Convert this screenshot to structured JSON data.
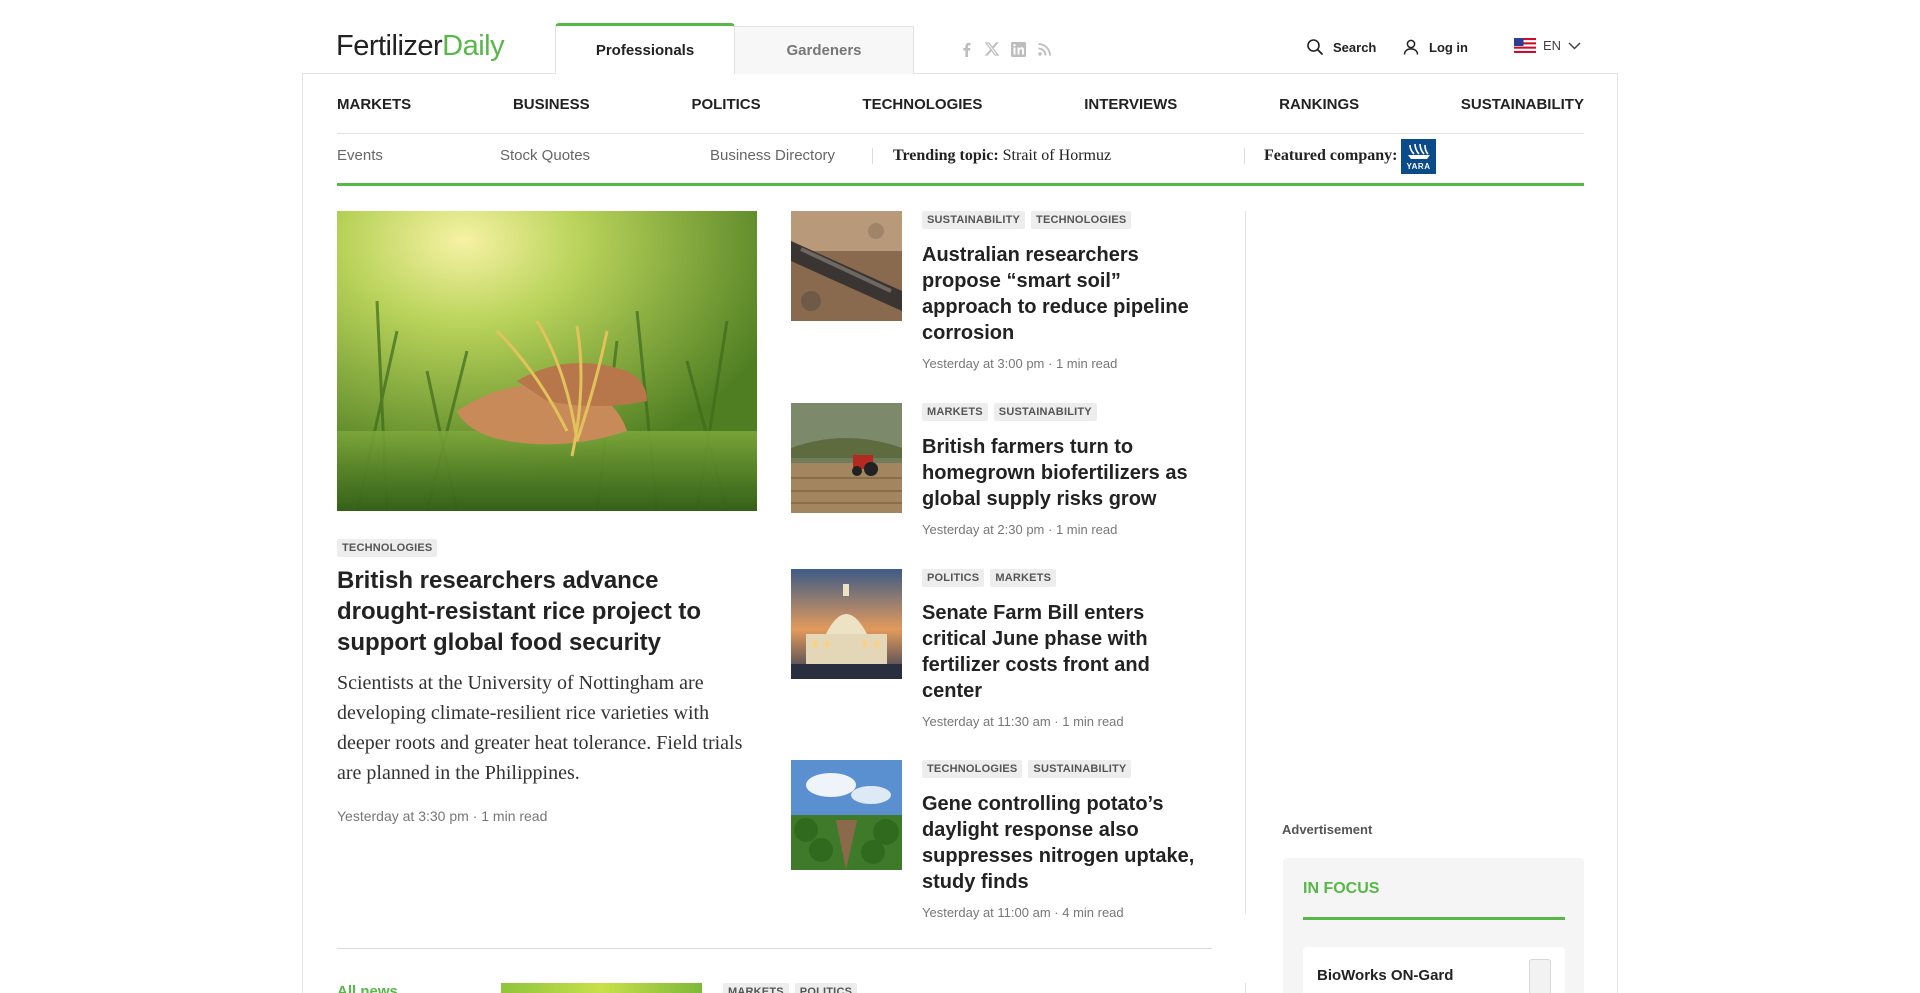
{
  "header": {
    "logo_part1": "Fertilizer",
    "logo_part2": "Daily",
    "audience_tabs": [
      {
        "label": "Professionals",
        "active": true
      },
      {
        "label": "Gardeners",
        "active": false
      }
    ],
    "social_icons": [
      "facebook-icon",
      "x-icon",
      "linkedin-icon",
      "rss-icon"
    ],
    "search_label": "Search",
    "login_label": "Log in",
    "language": "EN"
  },
  "main_nav": [
    "MARKETS",
    "BUSINESS",
    "POLITICS",
    "TECHNOLOGIES",
    "INTERVIEWS",
    "RANKINGS",
    "SUSTAINABILITY"
  ],
  "sub_nav": {
    "items": [
      "Events",
      "Stock Quotes",
      "Business Directory"
    ],
    "trending_label": "Trending topic:",
    "trending_value": "Strait of Hormuz",
    "featured_label": "Featured company:",
    "featured_logo_text": "YARA"
  },
  "featured_article": {
    "tags": [
      "TECHNOLOGIES"
    ],
    "title": "British researchers advance drought-resistant rice project to support global food security",
    "description": "Scientists at the University of Nottingham are developing climate-resilient rice varieties with deeper roots and greater heat tolerance. Field trials are planned in the Philippines.",
    "time": "Yesterday at 3:30 pm",
    "read": "· 1 min read"
  },
  "side_articles": [
    {
      "tags": [
        "SUSTAINABILITY",
        "TECHNOLOGIES"
      ],
      "title": "Australian researchers propose “smart soil” approach to reduce pipeline corrosion",
      "time": "Yesterday at 3:00 pm",
      "read": "· 1 min read"
    },
    {
      "tags": [
        "MARKETS",
        "SUSTAINABILITY"
      ],
      "title": "British farmers turn to homegrown biofertilizers as global supply risks grow",
      "time": "Yesterday at 2:30 pm",
      "read": "· 1 min read"
    },
    {
      "tags": [
        "POLITICS",
        "MARKETS"
      ],
      "title": "Senate Farm Bill enters critical June phase with fertilizer costs front and center",
      "time": "Yesterday at 11:30 am",
      "read": "· 1 min read"
    },
    {
      "tags": [
        "TECHNOLOGIES",
        "SUSTAINABILITY"
      ],
      "title": "Gene controlling potato’s daylight response also suppresses nitrogen uptake, study finds",
      "time": "Yesterday at 11:00 am",
      "read": "· 4 min read"
    }
  ],
  "sidebar": {
    "advertisement_label": "Advertisement",
    "in_focus_heading": "IN FOCUS",
    "in_focus_item": "BioWorks ON-Gard"
  },
  "bottom": {
    "all_news": "All news",
    "tags": [
      "MARKETS",
      "POLITICS"
    ]
  },
  "colors": {
    "brand_green": "#57b848",
    "text_dark": "#222222",
    "tag_bg": "#ededed"
  }
}
